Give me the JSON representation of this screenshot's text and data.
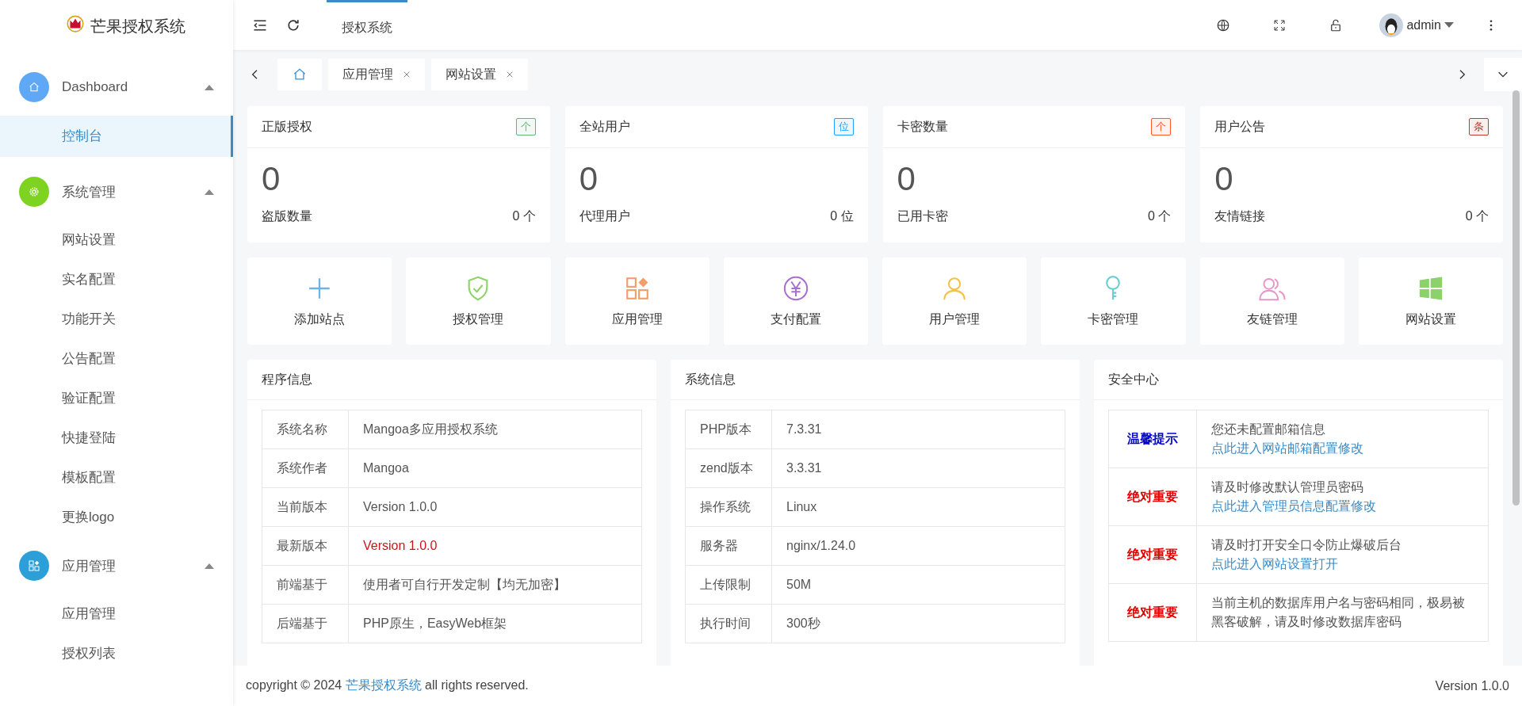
{
  "brand": {
    "title": "芒果授权系统"
  },
  "sidebar": {
    "groups": [
      {
        "label": "Dashboard",
        "color": "#5fa8f5",
        "expanded": true,
        "items": [
          {
            "label": "控制台",
            "selected": true
          }
        ]
      },
      {
        "label": "系统管理",
        "color": "#7ed321",
        "expanded": true,
        "items": [
          {
            "label": "网站设置",
            "selected": false
          },
          {
            "label": "实名配置",
            "selected": false
          },
          {
            "label": "功能开关",
            "selected": false
          },
          {
            "label": "公告配置",
            "selected": false
          },
          {
            "label": "验证配置",
            "selected": false
          },
          {
            "label": "快捷登陆",
            "selected": false
          },
          {
            "label": "模板配置",
            "selected": false
          },
          {
            "label": "更换logo",
            "selected": false
          }
        ]
      },
      {
        "label": "应用管理",
        "color": "#2d9fd8",
        "expanded": true,
        "items": [
          {
            "label": "应用管理",
            "selected": false
          },
          {
            "label": "授权列表",
            "selected": false
          }
        ]
      }
    ]
  },
  "header": {
    "nav_tabs": [
      {
        "label": "授权系统",
        "selected": true
      }
    ],
    "user": "admin"
  },
  "page_tabs": [
    {
      "kind": "home",
      "selected": true
    },
    {
      "kind": "text",
      "label": "应用管理",
      "selected": false
    },
    {
      "kind": "text",
      "label": "网站设置",
      "selected": false
    }
  ],
  "stats": [
    {
      "title": "正版授权",
      "badge": "个",
      "color": "#5fb878",
      "value": "0",
      "sub_label": "盗版数量",
      "sub_value": "0 个"
    },
    {
      "title": "全站用户",
      "badge": "位",
      "color": "#1e9fff",
      "value": "0",
      "sub_label": "代理用户",
      "sub_value": "0 位"
    },
    {
      "title": "卡密数量",
      "badge": "个",
      "color": "#ff5722",
      "value": "0",
      "sub_label": "已用卡密",
      "sub_value": "0 个"
    },
    {
      "title": "用户公告",
      "badge": "条",
      "color": "#c0392b",
      "value": "0",
      "sub_label": "友情链接",
      "sub_value": "0 个"
    }
  ],
  "shortcuts": [
    {
      "color": "#6fb3e0",
      "label": "添加站点"
    },
    {
      "color": "#8fd36a",
      "label": "授权管理"
    },
    {
      "color": "#f29e6b",
      "label": "应用管理"
    },
    {
      "color": "#a86fd1",
      "label": "支付配置"
    },
    {
      "color": "#f5c04a",
      "label": "用户管理"
    },
    {
      "color": "#6ccdd0",
      "label": "卡密管理"
    },
    {
      "color": "#e597c7",
      "label": "友链管理"
    },
    {
      "color": "#8bd26a",
      "label": "网站设置"
    }
  ],
  "program_info": {
    "title": "程序信息",
    "rows": [
      {
        "label": "系统名称",
        "value": "Mangoa多应用授权系统",
        "highlight": false
      },
      {
        "label": "系统作者",
        "value": "Mangoa",
        "highlight": false
      },
      {
        "label": "当前版本",
        "value": "Version 1.0.0",
        "highlight": false
      },
      {
        "label": "最新版本",
        "value": "Version 1.0.0",
        "highlight": true
      },
      {
        "label": "前端基于",
        "value": "使用者可自行开发定制【均无加密】",
        "highlight": false
      },
      {
        "label": "后端基于",
        "value": "PHP原生，EasyWeb框架",
        "highlight": false
      }
    ]
  },
  "system_info": {
    "title": "系统信息",
    "rows": [
      {
        "label": "PHP版本",
        "value": "7.3.31"
      },
      {
        "label": "zend版本",
        "value": "3.3.31"
      },
      {
        "label": "操作系统",
        "value": "Linux"
      },
      {
        "label": "服务器",
        "value": "nginx/1.24.0"
      },
      {
        "label": "上传限制",
        "value": "50M"
      },
      {
        "label": "执行时间",
        "value": "300秒"
      }
    ]
  },
  "security": {
    "title": "安全中心",
    "rows": [
      {
        "label": "温馨提示",
        "color": "#0000cc",
        "text": "您还未配置邮箱信息 ",
        "link": "点此进入网站邮箱配置修改"
      },
      {
        "label": "绝对重要",
        "color": "#e60000",
        "text": "请及时修改默认管理员密码 ",
        "link": "点此进入管理员信息配置修改"
      },
      {
        "label": "绝对重要",
        "color": "#e60000",
        "text": "请及时打开安全口令防止爆破后台 ",
        "link": "点此进入网站设置打开"
      },
      {
        "label": "绝对重要",
        "color": "#e60000",
        "text": "当前主机的数据库用户名与密码相同，极易被黑客破解，请及时修改数据库密码"
      }
    ]
  },
  "footer": {
    "copyright": "copyright © 2024 ",
    "link": "芒果授权系统",
    "rights": " all rights reserved.",
    "version": "Version 1.0.0"
  }
}
